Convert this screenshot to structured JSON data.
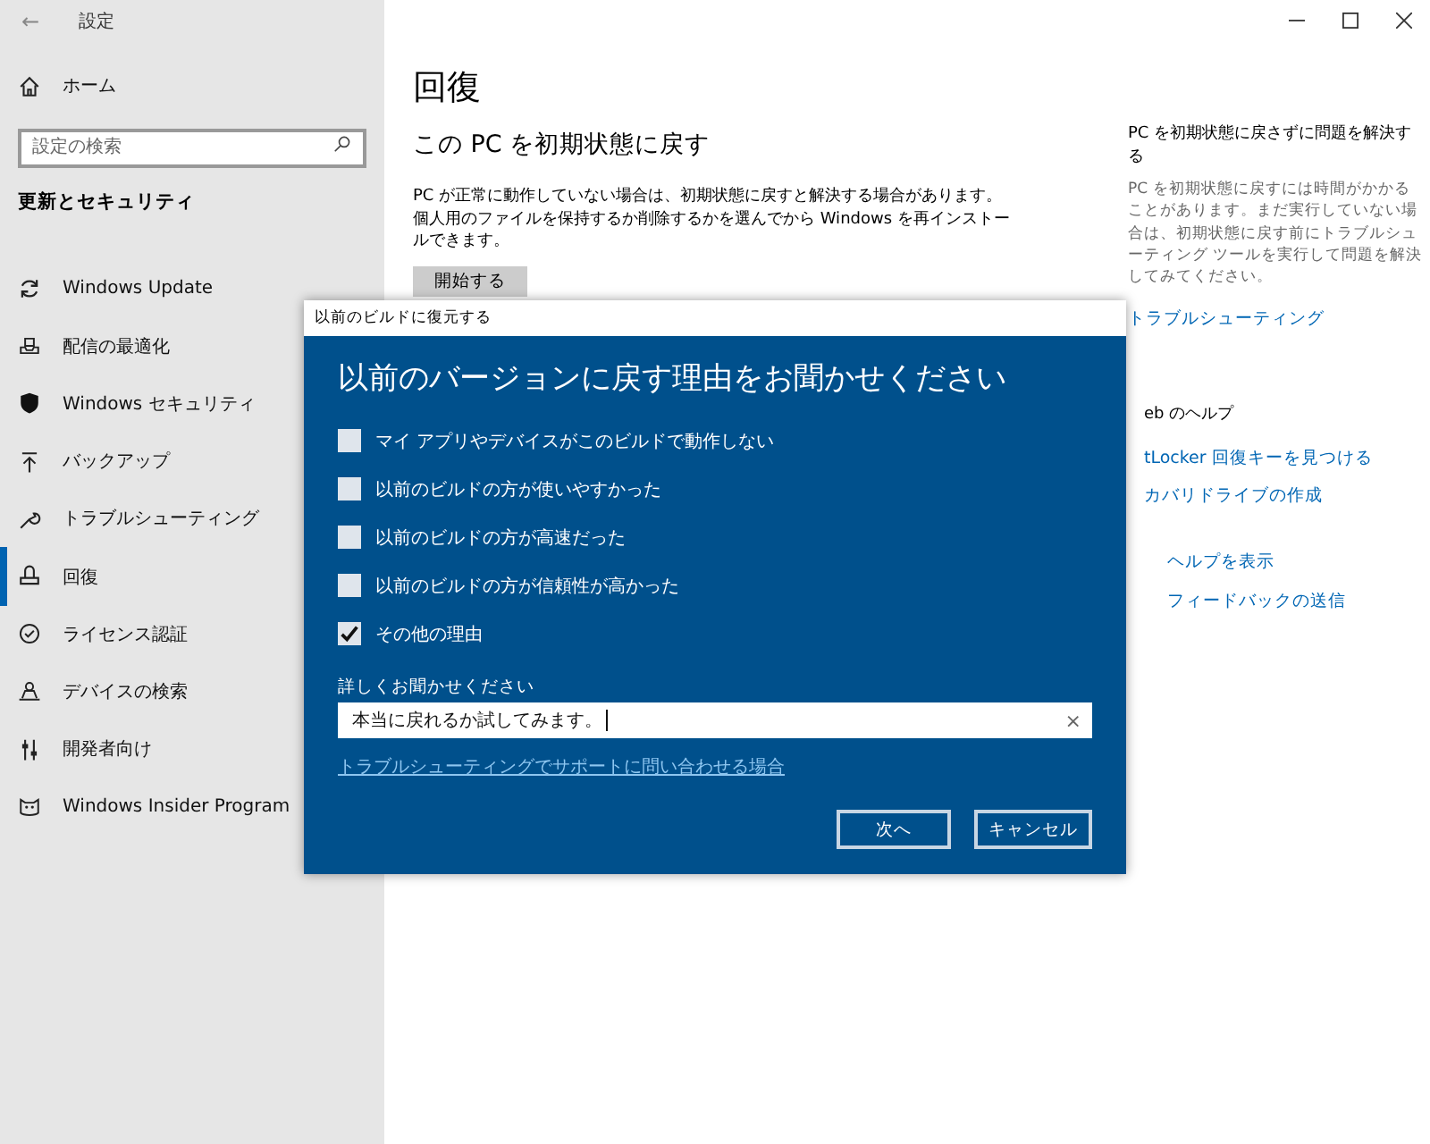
{
  "window": {
    "title": "設定",
    "back": "←"
  },
  "sidebar": {
    "home": "ホーム",
    "search": {
      "placeholder": "設定の検索"
    },
    "section": "更新とセキュリティ",
    "items": [
      {
        "label": "Windows Update",
        "kind": "update",
        "selected": false
      },
      {
        "label": "配信の最適化",
        "kind": "delivery",
        "selected": false
      },
      {
        "label": "Windows セキュリティ",
        "kind": "shield",
        "selected": false
      },
      {
        "label": "バックアップ",
        "kind": "backup",
        "selected": false
      },
      {
        "label": "トラブルシューティング",
        "kind": "wrench",
        "selected": false
      },
      {
        "label": "回復",
        "kind": "recovery",
        "selected": true
      },
      {
        "label": "ライセンス認証",
        "kind": "check",
        "selected": false
      },
      {
        "label": "デバイスの検索",
        "kind": "person",
        "selected": false
      },
      {
        "label": "開発者向け",
        "kind": "sliders",
        "selected": false
      },
      {
        "label": "Windows Insider Program",
        "kind": "insider",
        "selected": false
      }
    ]
  },
  "main": {
    "title": "回復",
    "section_title": "この PC を初期状態に戻す",
    "description": "PC が正常に動作していない場合は、初期状態に戻すと解決する場合があります。個人用のファイルを保持するか削除するかを選んでから Windows を再インストールできます。",
    "button": "開始する"
  },
  "side_panel": {
    "title": "PC を初期状態に戻さずに問題を解決する",
    "text": "PC を初期状態に戻すには時間がかかることがあります。まだ実行していない場合は、初期状態に戻す前にトラブルシューティング ツールを実行して問題を解決してみてください。",
    "link": "トラブルシューティング",
    "web_help_title": "eb のヘルプ",
    "web_links": [
      "tLocker 回復キーを見つける",
      "カバリドライブの作成"
    ],
    "help_links": [
      "ヘルプを表示",
      "フィードバックの送信"
    ]
  },
  "dialog": {
    "title": "以前のビルドに復元する",
    "heading": "以前のバージョンに戻す理由をお聞かせください",
    "options": [
      {
        "label": "マイ アプリやデバイスがこのビルドで動作しない",
        "checked": false
      },
      {
        "label": "以前のビルドの方が使いやすかった",
        "checked": false
      },
      {
        "label": "以前のビルドの方が高速だった",
        "checked": false
      },
      {
        "label": "以前のビルドの方が信頼性が高かった",
        "checked": false
      },
      {
        "label": "その他の理由",
        "checked": true
      }
    ],
    "details_label": "詳しくお聞かせください",
    "details_value": "本当に戻れるか試してみます。",
    "clear": "×",
    "link": "トラブルシューティングでサポートに問い合わせる場合",
    "buttons": [
      "次へ",
      "キャンセル"
    ]
  }
}
